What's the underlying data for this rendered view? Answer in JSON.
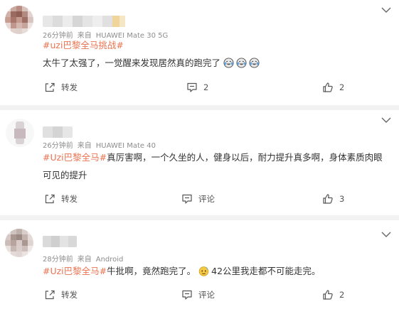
{
  "posts": [
    {
      "meta": {
        "time": "26分钟前",
        "from_label": "来自",
        "device": "HUAWEI Mate 30 5G"
      },
      "tag": "#uzi巴黎全马挑战#",
      "text_lines": [
        "太牛了太强了，一觉醒来发现居然真的跑完了"
      ],
      "actions": {
        "repost": "转发",
        "comment": "2",
        "like": "2"
      }
    },
    {
      "meta": {
        "time": "26分钟前",
        "from_label": "来自",
        "device": "HUAWEI Mate 40"
      },
      "tag": "#Uzi巴黎全马#",
      "text_lines": [
        "真厉害啊，一个久坐的人，健身以后，耐力提升真多啊，身体素质肉眼",
        "可见的提升"
      ],
      "actions": {
        "repost": "转发",
        "comment": "评论",
        "like": "3"
      }
    },
    {
      "meta": {
        "time": "28分钟前",
        "from_label": "来自",
        "device": "Android"
      },
      "tag": "#Uzi巴黎全马#",
      "text_lines": [
        "牛批啊，竟然跑完了。",
        "42公里我走都不可能走完。"
      ],
      "actions": {
        "repost": "转发",
        "comment": "评论",
        "like": "2"
      }
    }
  ],
  "icons": {
    "repost": "share-out-icon",
    "comment": "comment-icon",
    "like": "thumbs-up-icon",
    "menu": "chevron-down-icon",
    "emoji_laugh_cry": "laughing-tears-emoji",
    "emoji_sweat": "sweat-face-emoji"
  },
  "colors": {
    "tag": "#eb7350",
    "meta": "#8c8c8c",
    "text": "#333333",
    "divider": "#f2f2f2"
  }
}
